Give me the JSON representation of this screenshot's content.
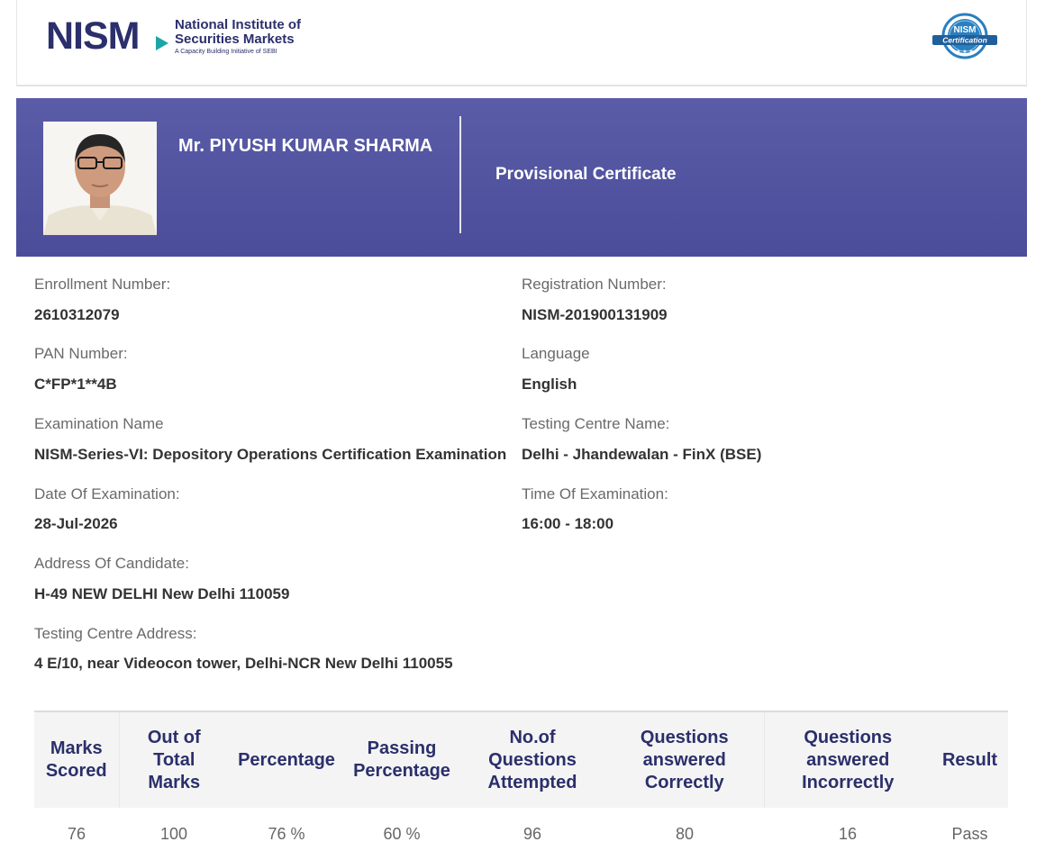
{
  "header": {
    "logo_mark": "NISM",
    "logo_line1": "National Institute of",
    "logo_line2": "Securities Markets",
    "logo_tagline": "A Capacity Building Initiative of SEBI",
    "badge_top": "NISM",
    "badge_ribbon": "Certification"
  },
  "banner": {
    "candidate_name": "Mr. PIYUSH KUMAR SHARMA",
    "certificate_title": "Provisional Certificate"
  },
  "details": {
    "enrollment_label": "Enrollment Number:",
    "enrollment_value": "2610312079",
    "registration_label": "Registration Number:",
    "registration_value": "NISM-201900131909",
    "pan_label": "PAN Number:",
    "pan_value": "C*FP*1**4B",
    "language_label": "Language",
    "language_value": "English",
    "exam_name_label": "Examination Name",
    "exam_name_value": "NISM-Series-VI: Depository Operations Certification Examination",
    "centre_name_label": "Testing Centre Name:",
    "centre_name_value": "Delhi - Jhandewalan - FinX (BSE)",
    "exam_date_label": "Date Of Examination:",
    "exam_date_value": "28-Jul-2026",
    "exam_time_label": "Time Of Examination:",
    "exam_time_value": "16:00 - 18:00",
    "address_label": "Address Of Candidate:",
    "address_value": "H-49 NEW DELHI New Delhi 110059",
    "centre_address_label": "Testing Centre Address:",
    "centre_address_value": "4 E/10, near Videocon tower, Delhi-NCR New Delhi 110055"
  },
  "results": {
    "headers": {
      "marks_scored": [
        "Marks",
        "Scored"
      ],
      "total_marks": [
        "Out of",
        "Total",
        "Marks"
      ],
      "percentage": [
        "Percentage"
      ],
      "passing_percentage": [
        "Passing",
        "Percentage"
      ],
      "attempted": [
        "No.of",
        "Questions",
        "Attempted"
      ],
      "correct": [
        "Questions",
        "answered",
        "Correctly"
      ],
      "incorrect": [
        "Questions",
        "answered",
        "Incorrectly"
      ],
      "result": [
        "Result"
      ]
    },
    "row": {
      "marks_scored": "76",
      "total_marks": "100",
      "percentage": "76 %",
      "passing_percentage": "60 %",
      "attempted": "96",
      "correct": "80",
      "incorrect": "16",
      "result": "Pass"
    }
  },
  "colors": {
    "banner": "#5a5ca8",
    "logo_navy": "#2b2f6b",
    "logo_teal": "#1aa6a6",
    "badge_blue": "#2a7fc0"
  }
}
